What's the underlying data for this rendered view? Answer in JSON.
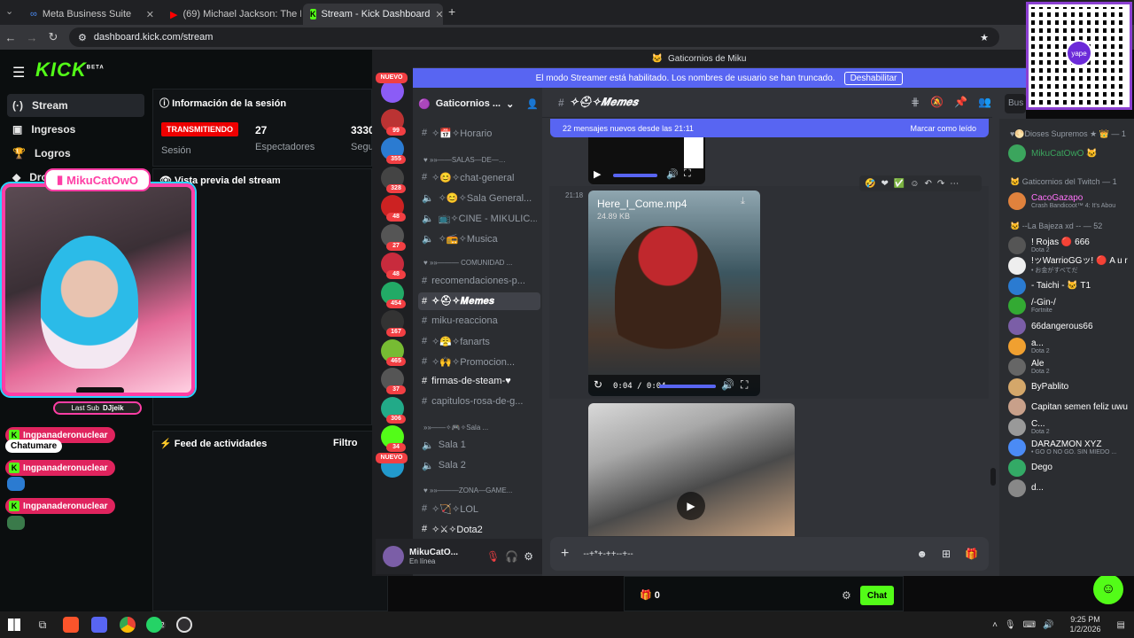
{
  "browser": {
    "tabs": [
      {
        "label": "Meta Business Suite",
        "active": false
      },
      {
        "label": "(69) Michael Jackson: The Man",
        "active": false
      },
      {
        "label": "Stream - Kick Dashboard",
        "active": true
      }
    ],
    "url": "dashboard.kick.com/stream"
  },
  "kick": {
    "logo": "KICK",
    "logo_beta": "BETA",
    "nav": [
      {
        "label": "Stream",
        "icon": "radio-icon"
      },
      {
        "label": "Ingresos",
        "icon": "wallet-icon"
      },
      {
        "label": "Logros",
        "icon": "trophy-icon"
      },
      {
        "label": "Dro",
        "icon": "drops-icon"
      }
    ],
    "session": {
      "title": "Información de la sesión",
      "status": "TRANSMITIENDO",
      "status_caption": "Sesión",
      "viewers_value": "27",
      "viewers_label": "Espectadores",
      "followers_value": "3330",
      "followers_label": "Segu"
    },
    "preview_title": "Vista previa del stream",
    "activity_title": "Feed de actividades",
    "activity_filter": "Filtro",
    "chat_points": "0",
    "chat_button": "Chat"
  },
  "overlay": {
    "cam_name": "MikuCatOwO",
    "last_sub_label": "Last Sub",
    "last_sub_user": "DJjeik",
    "alerts": [
      "Ingpanaderonuclear",
      "Chatumare",
      "Ingpanaderonuclear",
      "Ingpanaderonuclear"
    ]
  },
  "discord": {
    "window_title": "Gaticornios de Miku",
    "streamer_banner": "El modo Streamer está habilitado. Los nombres de usuario se han truncado.",
    "streamer_button": "Deshabilitar",
    "server_name": "Gaticornios ...",
    "channel_header": "✧⛑✧𝑴𝒆𝒎𝒆𝒔",
    "new_messages": "22 mensajes nuevos desde las 21:11",
    "mark_read": "Marcar como leído",
    "server_badges": [
      "NUEVO",
      "99",
      "355",
      "328",
      "48",
      "27",
      "48",
      "454",
      "167",
      "465",
      "37",
      "306",
      "34",
      "NUEVO"
    ],
    "channels": [
      {
        "type": "text",
        "label": "✧📅✧Horario"
      },
      {
        "type": "cat",
        "label": "♥ »»——SALAS—DE—…"
      },
      {
        "type": "text",
        "label": "✧😊✧chat-general"
      },
      {
        "type": "voice",
        "label": "✧😊✧Sala General..."
      },
      {
        "type": "voice",
        "label": "📺✧CINE - MIKULIC..."
      },
      {
        "type": "voice",
        "label": "✧📻✧Musica"
      },
      {
        "type": "cat",
        "label": "♥ »»——— COMUNIDAD ..."
      },
      {
        "type": "text",
        "label": "recomendaciones-p..."
      },
      {
        "type": "text",
        "label": "✧⛑✧𝑴𝒆𝒎𝒆𝒔",
        "selected": true
      },
      {
        "type": "text",
        "label": "miku-reacciona"
      },
      {
        "type": "text",
        "label": "✧😤✧fanarts"
      },
      {
        "type": "text",
        "label": "✧🙌✧Promocion..."
      },
      {
        "type": "text",
        "label": "firmas-de-steam-♥",
        "white": true
      },
      {
        "type": "text",
        "label": "capitulos-rosa-de-g..."
      },
      {
        "type": "cat",
        "label": "»»——✧🎮✧Sala ..."
      },
      {
        "type": "voice",
        "label": "Sala 1"
      },
      {
        "type": "voice",
        "label": "Sala 2"
      },
      {
        "type": "cat",
        "label": "♥ »»———ZONA—GAME..."
      },
      {
        "type": "text",
        "label": "✧🏹✧LOL"
      },
      {
        "type": "text",
        "label": "✧⚔✧Dota2",
        "white": true
      }
    ],
    "user": {
      "name": "MikuCatO...",
      "status": "En línea"
    },
    "message_time": "21:18",
    "video": {
      "filename": "Here_I_Come.mp4",
      "size": "24.89 KB",
      "time": "0:04 / 0:04",
      "progress": 1.0
    },
    "composer_placeholder": "--+*+-++--+--",
    "member_groups": [
      {
        "title": "♥🌕Dioses Supremos ★ 👑 — 1",
        "members": [
          {
            "name": "MikuCatOwO 🐱",
            "status": "",
            "color": "#3ba55d"
          }
        ]
      },
      {
        "title": "🐱 Gaticornios del Twitch — 1",
        "members": [
          {
            "name": "CacoGazapo",
            "status": "Crash Bandicoot™ 4: It's Abou",
            "color": "#ff73fa"
          }
        ]
      },
      {
        "title": "🐱 --La Bajeza xd -- — 52",
        "members": [
          {
            "name": "! Rojas 🔴 666",
            "status": "Dota 2",
            "color": "#ffffff"
          },
          {
            "name": "!ッWarrioGGッ! 🔴 A u r",
            "status": "• お金がすべてだ",
            "color": "#ffffff"
          },
          {
            "name": "- Taichi - 🐱 T1",
            "status": "",
            "color": "#ffffff"
          },
          {
            "name": "/-Gin-/",
            "status": "Fortnite",
            "color": "#ffffff"
          },
          {
            "name": "66dangerous66",
            "status": "",
            "color": "#ffffff"
          },
          {
            "name": "a...",
            "status": "Dota 2",
            "color": "#ffffff"
          },
          {
            "name": "Ale",
            "status": "Dota 2",
            "color": "#ffffff"
          },
          {
            "name": "ByPablito",
            "status": "",
            "color": "#ffffff"
          },
          {
            "name": "Capitan semen feliz uwu",
            "status": "",
            "color": "#ffffff"
          },
          {
            "name": "C...",
            "status": "Dota 2",
            "color": "#ffffff"
          },
          {
            "name": "DARAZMON XYZ",
            "status": "• GO O NO GO. SIN MIEDO ...",
            "color": "#ffffff"
          },
          {
            "name": "Dego",
            "status": "",
            "color": "#ffffff"
          },
          {
            "name": "d...",
            "status": "",
            "color": "#ffffff"
          }
        ]
      }
    ],
    "search_placeholder": "Bus"
  },
  "taskbar": {
    "time": "9:25 PM",
    "date": "1/2/2026",
    "badge": "72"
  }
}
